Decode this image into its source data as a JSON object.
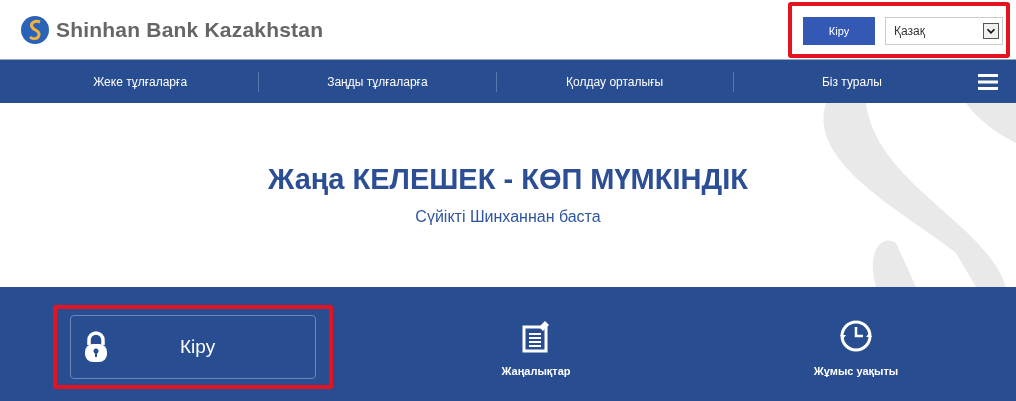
{
  "header": {
    "logo_text": "Shinhan Bank Kazakhstan",
    "login_button": "Кіру",
    "language_select": {
      "value": "Қазақ"
    },
    "highlighted": true
  },
  "nav": {
    "items": [
      {
        "label": "Жеке тұлғаларға"
      },
      {
        "label": "Заңды тұлғаларға"
      },
      {
        "label": "Қолдау орталығы"
      },
      {
        "label": "Біз туралы"
      }
    ]
  },
  "hero": {
    "title": "Жаңа КЕЛЕШЕК - КӨП МҮМКІНДІК",
    "subtitle": "Сүйікті Шинханнан баста"
  },
  "tiles": [
    {
      "kind": "login",
      "label": "Кіру",
      "highlighted": true
    },
    {
      "kind": "news",
      "label": "Жаңалықтар",
      "highlighted": false
    },
    {
      "kind": "hours",
      "label": "Жұмыс уақыты",
      "highlighted": false
    }
  ]
}
